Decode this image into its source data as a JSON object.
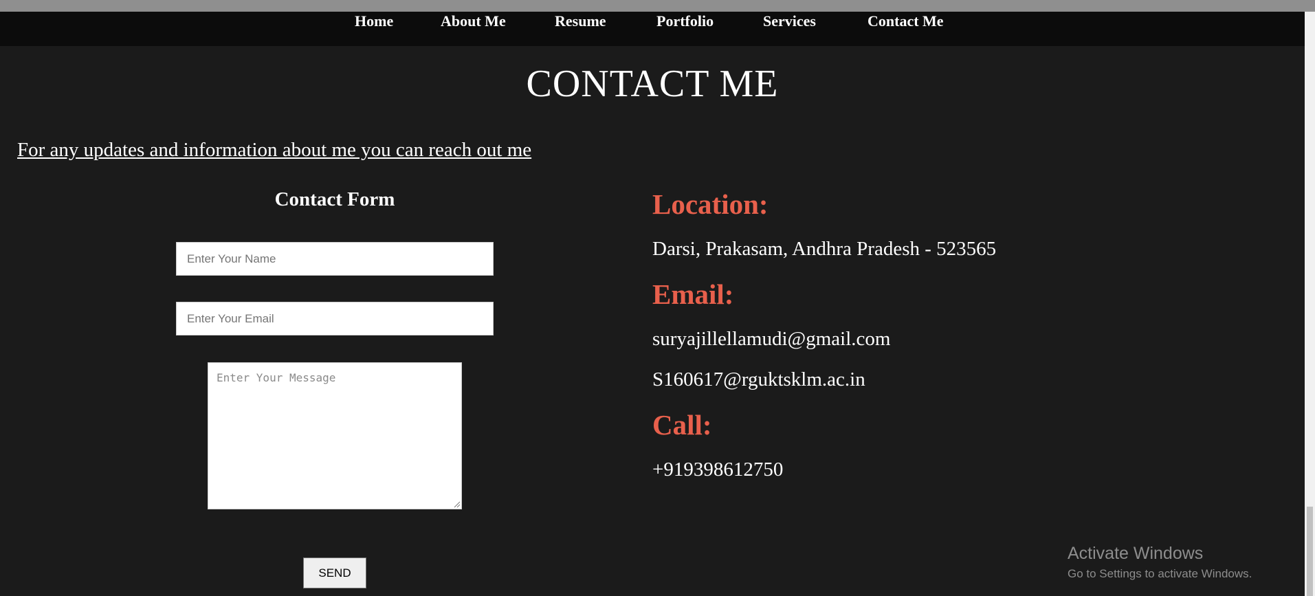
{
  "nav": {
    "items": [
      {
        "label": "Home"
      },
      {
        "label": "About Me"
      },
      {
        "label": "Resume"
      },
      {
        "label": "Portfolio"
      },
      {
        "label": "Services"
      },
      {
        "label": "Contact Me"
      }
    ]
  },
  "page": {
    "title": "CONTACT ME",
    "intro": "For any updates and information about me you can reach out me"
  },
  "form": {
    "title": "Contact Form",
    "name_placeholder": "Enter Your Name",
    "email_placeholder": "Enter Your Email",
    "message_placeholder": "Enter Your Message",
    "send_label": "SEND"
  },
  "contact": {
    "location_heading": "Location:",
    "location": "Darsi, Prakasam, Andhra Pradesh - 523565",
    "email_heading": "Email:",
    "email_primary": "suryajillellamudi@gmail.com",
    "email_secondary": "S160617@rguktsklm.ac.in",
    "call_heading": "Call:",
    "phone": "+919398612750"
  },
  "watermark": {
    "title": "Activate Windows",
    "subtitle": "Go to Settings to activate Windows."
  },
  "colors": {
    "background": "#1b1b1b",
    "navbar": "#0c0c0c",
    "accent": "#e8604c",
    "text": "#ffffff"
  }
}
